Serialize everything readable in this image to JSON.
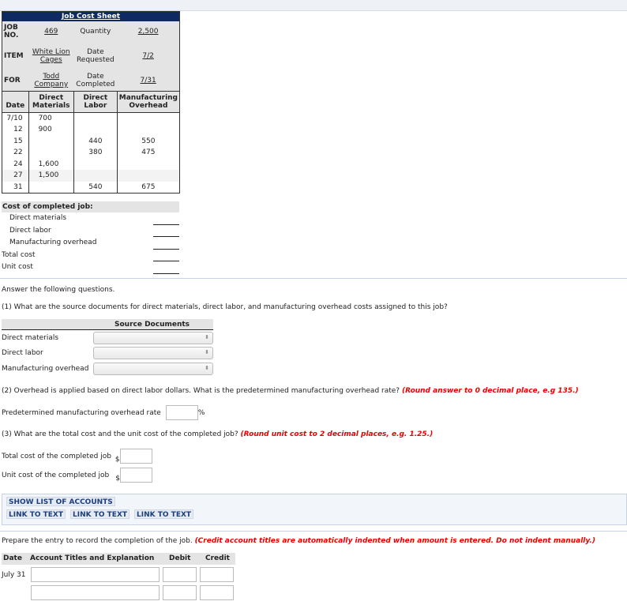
{
  "job_cost_sheet": {
    "title": "Job Cost Sheet",
    "job_no_label": "JOB NO.",
    "job_no": "469",
    "quantity_label": "Quantity",
    "quantity": "2,500",
    "item_label": "ITEM",
    "item": "White Lion Cages",
    "date_requested_label": "Date Requested",
    "date_requested": "7/2",
    "for_label": "FOR",
    "for": "Todd Company",
    "date_completed_label": "Date Completed",
    "date_completed": "7/31",
    "columns": [
      "Date",
      "Direct Materials",
      "Direct Labor",
      "Manufacturing Overhead"
    ],
    "rows": [
      {
        "date": "7/10",
        "dm": "700",
        "dl": "",
        "mo": ""
      },
      {
        "date": "12",
        "dm": "900",
        "dl": "",
        "mo": ""
      },
      {
        "date": "15",
        "dm": "",
        "dl": "440",
        "mo": "550"
      },
      {
        "date": "22",
        "dm": "",
        "dl": "380",
        "mo": "475"
      },
      {
        "date": "24",
        "dm": "1,600",
        "dl": "",
        "mo": ""
      },
      {
        "date": "27",
        "dm": "1,500",
        "dl": "",
        "mo": ""
      },
      {
        "date": "31",
        "dm": "",
        "dl": "540",
        "mo": "675"
      }
    ]
  },
  "cost_summary": {
    "heading": "Cost of completed job:",
    "direct_materials": "Direct materials",
    "direct_labor": "Direct labor",
    "overhead": "Manufacturing overhead",
    "total_cost": "Total cost",
    "unit_cost": "Unit cost"
  },
  "questions": {
    "intro": "Answer the following questions.",
    "q1": "(1) What are the source documents for direct materials, direct labor, and manufacturing overhead costs assigned to this job?",
    "source_header": "Source Documents",
    "source_rows": [
      "Direct materials",
      "Direct labor",
      "Manufacturing overhead"
    ],
    "q2": "(2) Overhead is applied based on direct labor dollars. What is the predetermined manufacturing overhead rate?",
    "q2_note": "(Round answer to 0 decimal place, e.g 135.)",
    "rate_label": "Predetermined manufacturing overhead rate",
    "rate_unit": "%",
    "q3": "(3) What are the total cost and the unit cost of the completed job?",
    "q3_note": "(Round unit cost to 2 decimal places, e.g. 1.25.)",
    "total_label": "Total cost of the completed job",
    "unit_label": "Unit cost of the completed job",
    "currency": "$"
  },
  "links": {
    "show_accounts": "SHOW LIST OF ACCOUNTS",
    "link_text": [
      "LINK TO TEXT",
      "LINK TO TEXT",
      "LINK TO TEXT"
    ]
  },
  "journal": {
    "prompt": "Prepare the entry to record the completion of the job.",
    "note": "(Credit account titles are automatically indented when amount is entered. Do not indent manually.)",
    "headers": {
      "date": "Date",
      "account": "Account Titles and Explanation",
      "debit": "Debit",
      "credit": "Credit"
    },
    "date": "July 31"
  }
}
